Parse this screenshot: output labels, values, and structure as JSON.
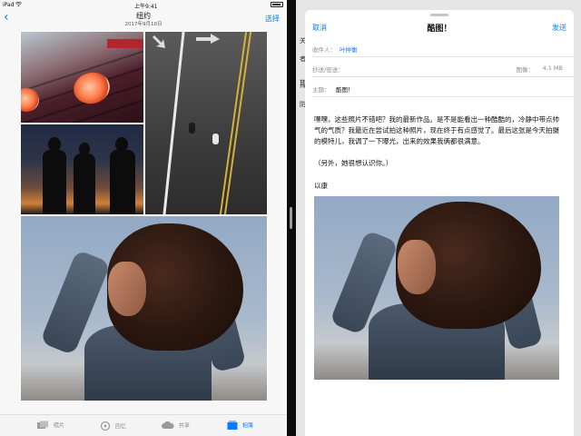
{
  "status_bar": {
    "device": "iPad",
    "time": "上午9:41"
  },
  "photos": {
    "back_icon": "chevron-left-icon",
    "title": "纽约",
    "subtitle": "2017年9月10日",
    "select_label": "选择",
    "tabs": [
      {
        "label": "照片",
        "icon": "photos-icon",
        "active": false
      },
      {
        "label": "回忆",
        "icon": "memories-icon",
        "active": false
      },
      {
        "label": "共享",
        "icon": "cloud-icon",
        "active": false
      },
      {
        "label": "相簿",
        "icon": "albums-icon",
        "active": true
      }
    ]
  },
  "mail": {
    "cancel_label": "取消",
    "title": "酷图！",
    "send_label": "发送",
    "to_label": "收件人：",
    "to_value": "叶仲衡",
    "cc_label": "抄送/密送：",
    "image_label": "图像：",
    "image_size": "4.1 MB",
    "subject_label": "主题：",
    "subject_value": "酷图！",
    "body_line1": "嘿嘿，这些照片不错吧？我的最新作品。是不是能看出一种酷酷的，冷静中带点帅气的气质？我最近在尝试拍这种照片，现在终于有点感觉了。最后这张是今天拍摄的模特儿，我调了一下曝光，出来的效果我俩都很满意。",
    "body_line2": "（另外，她很想认识你。）",
    "signature": "以康"
  },
  "behind_sheet": {
    "chars": [
      "关",
      "者",
      "斯",
      "防"
    ]
  },
  "colors": {
    "accent": "#0a7aff",
    "background": "#f7f7f7"
  }
}
